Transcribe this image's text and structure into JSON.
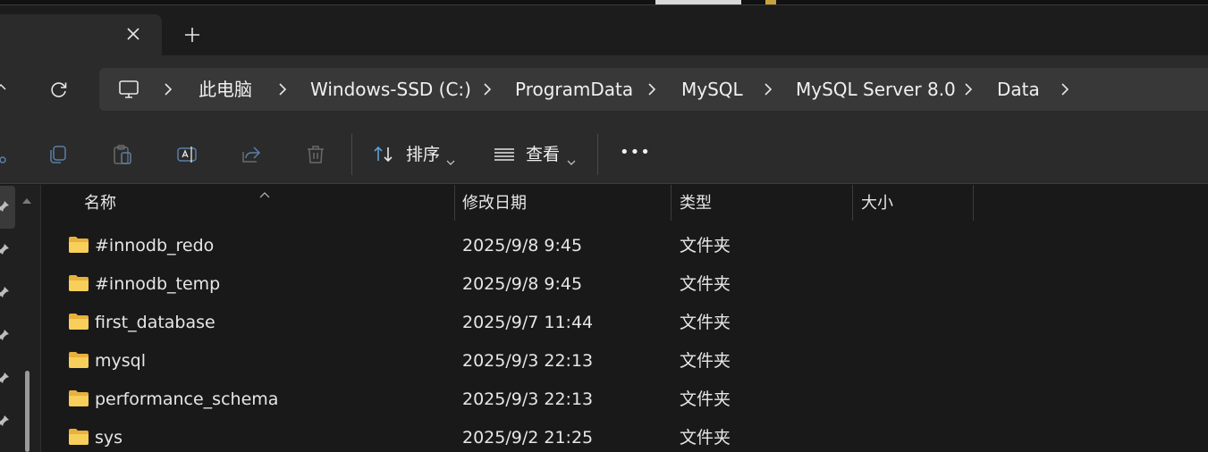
{
  "tab": {
    "close_icon": "close-icon",
    "new_tab_icon": "plus-icon"
  },
  "breadcrumbs": [
    "此电脑",
    "Windows-SSD (C:)",
    "ProgramData",
    "MySQL",
    "MySQL Server 8.0",
    "Data"
  ],
  "toolbar": {
    "sort_label": "排序",
    "view_label": "查看",
    "more_label": "•••"
  },
  "columns": {
    "name": "名称",
    "modified": "修改日期",
    "type": "类型",
    "size": "大小"
  },
  "files": [
    {
      "name": "#innodb_redo",
      "modified": "2025/9/8 9:45",
      "type": "文件夹"
    },
    {
      "name": "#innodb_temp",
      "modified": "2025/9/8 9:45",
      "type": "文件夹"
    },
    {
      "name": "first_database",
      "modified": "2025/9/7 11:44",
      "type": "文件夹"
    },
    {
      "name": "mysql",
      "modified": "2025/9/3 22:13",
      "type": "文件夹"
    },
    {
      "name": "performance_schema",
      "modified": "2025/9/3 22:13",
      "type": "文件夹"
    },
    {
      "name": "sys",
      "modified": "2025/9/2 21:25",
      "type": "文件夹"
    }
  ],
  "colors": {
    "background": "#191919",
    "toolbar": "#2b2b2b",
    "addressbar": "#383838",
    "folder": "#f2c14e"
  }
}
